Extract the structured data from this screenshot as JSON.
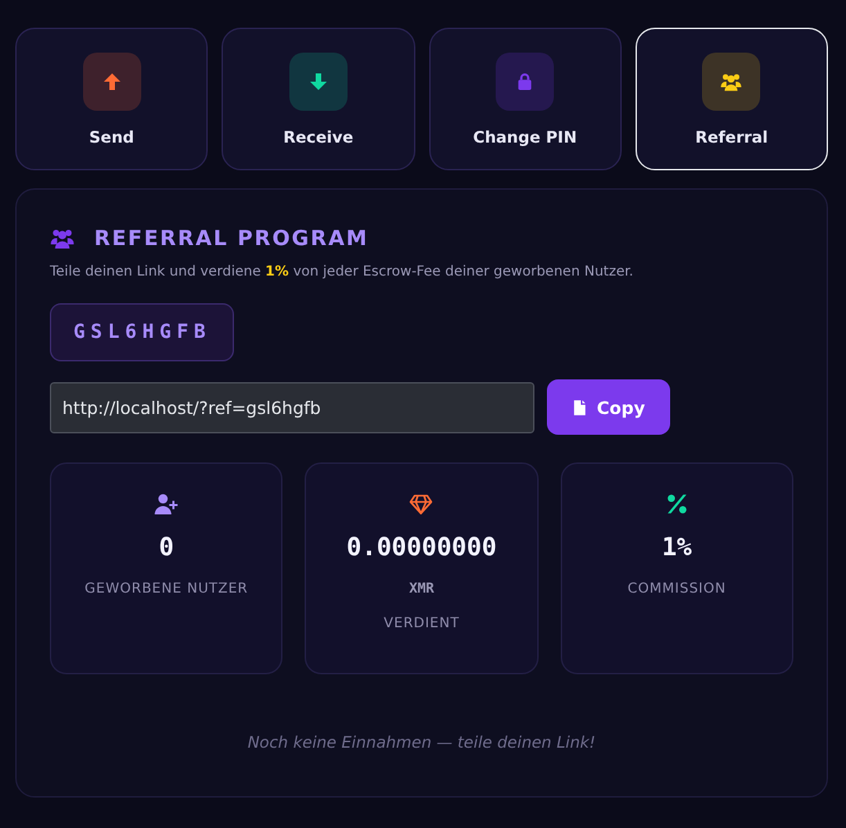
{
  "actions": [
    {
      "label": "Send",
      "kind": "arrow-up",
      "color": "#ff6b35",
      "selected": false
    },
    {
      "label": "Receive",
      "kind": "arrow-down",
      "color": "#10d9a0",
      "selected": false
    },
    {
      "label": "Change PIN",
      "kind": "lock",
      "color": "#7c3aed",
      "selected": false
    },
    {
      "label": "Referral",
      "kind": "users",
      "color": "#facc15",
      "selected": true
    }
  ],
  "referral": {
    "title": "REFERRAL PROGRAM",
    "description": "Teile deinen Link und verdiene **1%** von jeder Escrow-Fee deiner geworbenen Nutzer.",
    "code": "GSL6HGFB",
    "link": "http://localhost/?ref=gsl6hgfb",
    "copy_button": "Copy",
    "stats": [
      {
        "kind": "user-plus",
        "color": "#a78bfa",
        "value": "0",
        "label": "GEWORBENE NUTZER"
      },
      {
        "kind": "gem",
        "color": "#ff6b35",
        "value": "0.00000000",
        "unit": "XMR",
        "label": "VERDIENT"
      },
      {
        "kind": "percent",
        "color": "#10d9a0",
        "value": "1%",
        "label": "COMMISSION"
      }
    ],
    "empty_note": "Noch keine Einnahmen — teile deinen Link!"
  }
}
